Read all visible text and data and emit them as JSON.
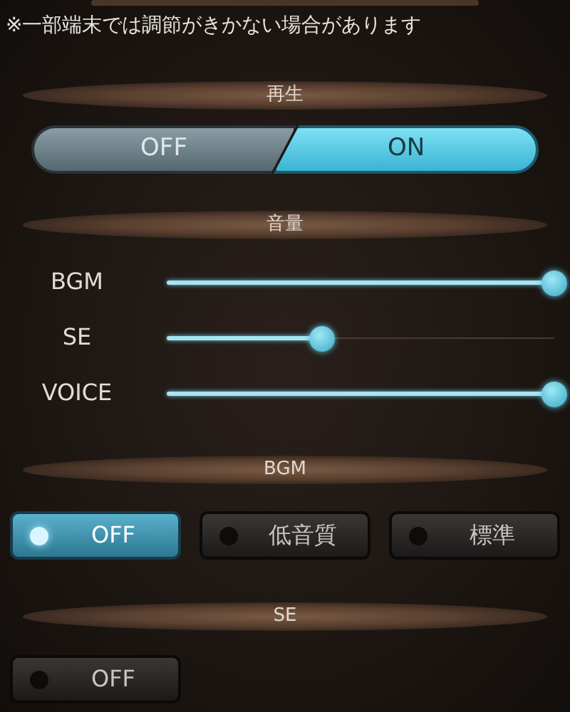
{
  "notice": "※一部端末では調節がきかない場合があります",
  "playback": {
    "title": "再生",
    "options": [
      {
        "label": "OFF",
        "selected": false
      },
      {
        "label": "ON",
        "selected": true
      }
    ]
  },
  "volume": {
    "title": "音量",
    "sliders": [
      {
        "label": "BGM",
        "level": 1
      },
      {
        "label": "SE",
        "level": 0.4
      },
      {
        "label": "VOICE",
        "level": 1
      }
    ]
  },
  "bgm": {
    "title": "BGM",
    "options": [
      {
        "label": "OFF",
        "selected": true
      },
      {
        "label": "低音質",
        "selected": false
      },
      {
        "label": "標準",
        "selected": false
      }
    ]
  },
  "se": {
    "title": "SE",
    "options": [
      {
        "label": "OFF",
        "selected": false
      }
    ]
  }
}
